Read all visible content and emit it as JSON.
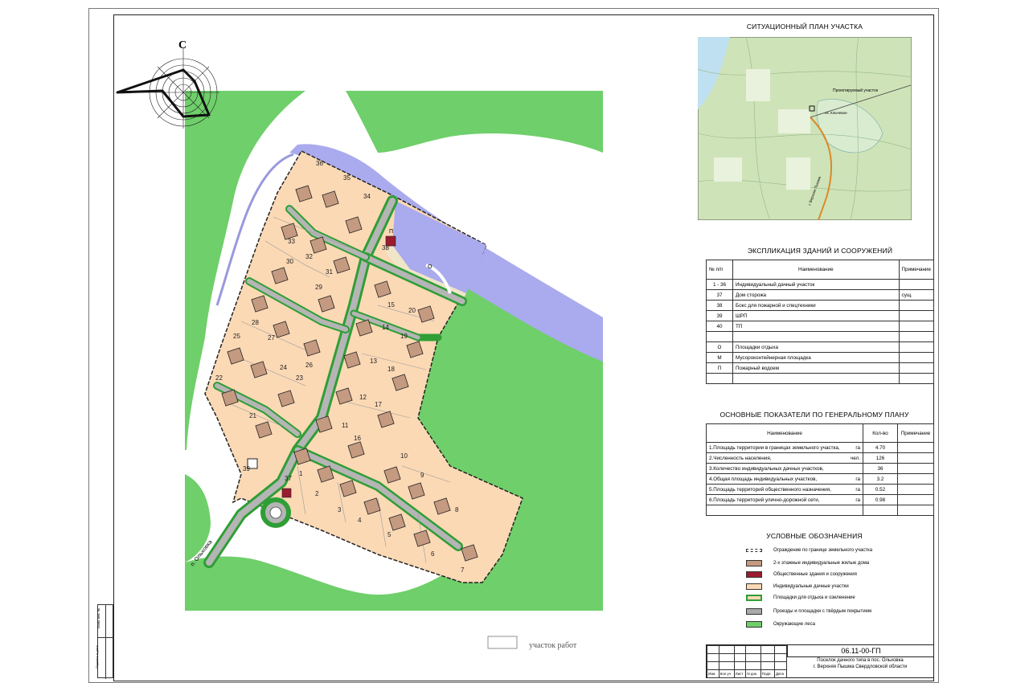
{
  "site_plan": {
    "title": "СИТУАЦИОННЫЙ ПЛАН УЧАСТКА",
    "marker_label": "Проектируемый участок",
    "lake_label": "оз. Ключевое",
    "road_label": "г. Верхняя Пышма"
  },
  "compass": {
    "north": "С"
  },
  "map_labels": {
    "street": "п. Ольховка",
    "bottom_caption": "участок работ",
    "codes": {
      "pond": "П",
      "rest": "О",
      "waste": "М"
    }
  },
  "explication": {
    "title": "ЭКСПЛИКАЦИЯ ЗДАНИЙ И СООРУЖЕНИЙ",
    "headers": [
      "№ п/п",
      "Наименование",
      "Примечание"
    ],
    "rows": [
      {
        "num": "1 - 36",
        "name": "Индивидуальный дачный участок",
        "note": ""
      },
      {
        "num": "37",
        "name": "Дом сторожа",
        "note": "сущ."
      },
      {
        "num": "38",
        "name": "Бокс для пожарной и спецтехники",
        "note": ""
      },
      {
        "num": "39",
        "name": "ШРП",
        "note": ""
      },
      {
        "num": "40",
        "name": "ТП",
        "note": ""
      },
      {
        "num": "",
        "name": "",
        "note": ""
      },
      {
        "num": "О",
        "name": "Площадки отдыха",
        "note": ""
      },
      {
        "num": "М",
        "name": "Мусороконтейнерная площадка",
        "note": ""
      },
      {
        "num": "П",
        "name": "Пожарный водоем",
        "note": ""
      },
      {
        "num": "",
        "name": "",
        "note": ""
      }
    ]
  },
  "indicators": {
    "title": "ОСНОВНЫЕ ПОКАЗАТЕЛИ ПО  ГЕНЕРАЛЬНОМУ ПЛАНУ",
    "headers": [
      "Наименование",
      "Кол-во",
      "Примечание"
    ],
    "rows": [
      {
        "name": "1.Площадь территории в границах земельного участка,",
        "unit": "га",
        "value": "4.70"
      },
      {
        "name": "2.Численность населения,",
        "unit": "чел.",
        "value": "126"
      },
      {
        "name": "3.Количество индивидуальных дачных участков,",
        "unit": "",
        "value": "36"
      },
      {
        "name": "4.Общая площадь индивидуальных участков,",
        "unit": "га",
        "value": "3.2"
      },
      {
        "name": "5.Площадь территорий общественного назначения,",
        "unit": "га",
        "value": "0.52"
      },
      {
        "name": "6.Площадь территорий улично-дорожной сети,",
        "unit": "га",
        "value": "0.98"
      },
      {
        "name": "",
        "unit": "",
        "value": ""
      }
    ]
  },
  "legend": {
    "title": "УСЛОВНЫЕ ОБОЗНАЧЕНИЯ",
    "items": [
      {
        "label": "Ограждение по границе земельного участка",
        "color": "#ffffff"
      },
      {
        "label": "2-х этажные индивидуальные жилые дома",
        "color": "#c49a80"
      },
      {
        "label": "Общественные здания и сооружения",
        "color": "#9b1b30"
      },
      {
        "label": "Индивидуальные дачные участки",
        "color": "#fbd9b5"
      },
      {
        "label": "Площадки для отдыха и озеленение",
        "color": "#2f9e36"
      },
      {
        "label": "Проезды и площадки с твёрдым покрытием",
        "color": "#a9a9a9"
      },
      {
        "label": "Окружающие леса",
        "color": "#6fcf6a"
      }
    ]
  },
  "stamp": {
    "code": "06.11-00-ГП",
    "line1": "Поселок дачного типа в пос. Ольховка",
    "line2": "г. Верхняя Пышма Свердловской области",
    "cols": [
      "Изм.",
      "Кол.уч",
      "Лист",
      "N док.",
      "Подп.",
      "Дата"
    ]
  },
  "side_stamp": {
    "a": "Взам. инв. №",
    "b": "Подпись и дата"
  },
  "colors": {
    "forest": "#6fcf6a",
    "lot": "#fbd9b5",
    "house": "#c49a80",
    "water": "#aaaaee",
    "green": "#2f9e36"
  },
  "lots": [
    "1",
    "2",
    "3",
    "4",
    "5",
    "6",
    "7",
    "8",
    "9",
    "10",
    "11",
    "12",
    "13",
    "14",
    "15",
    "16",
    "17",
    "18",
    "19",
    "20",
    "21",
    "22",
    "23",
    "24",
    "25",
    "26",
    "27",
    "28",
    "29",
    "30",
    "31",
    "32",
    "33",
    "34",
    "35",
    "36",
    "37",
    "38",
    "39"
  ]
}
